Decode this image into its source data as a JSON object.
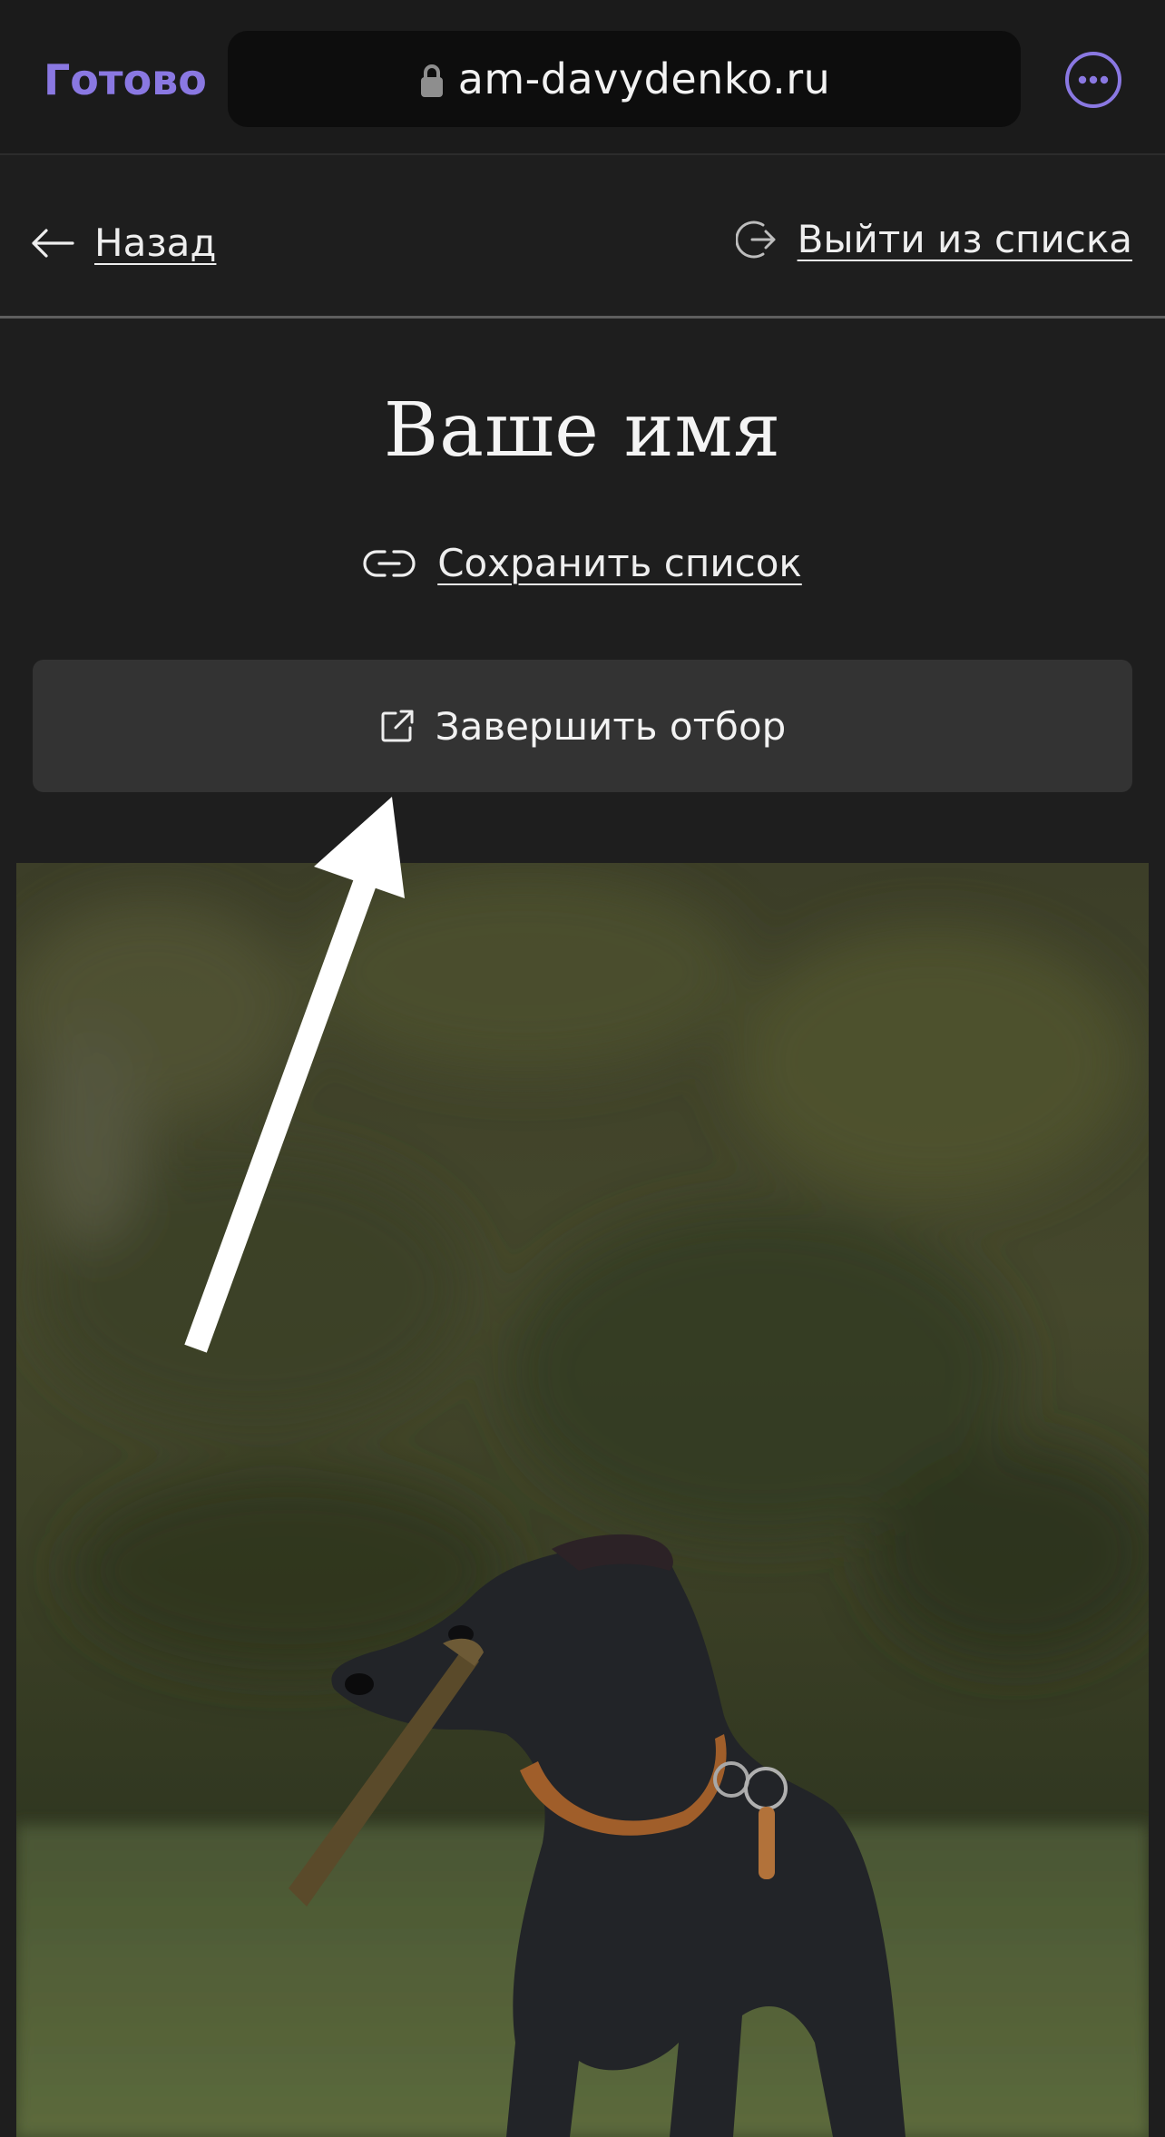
{
  "browser": {
    "done_label": "Готово",
    "url": "am-davydenko.ru",
    "accent_color": "#8a78e2",
    "lock_icon": "lock-icon",
    "more_icon": "ellipsis-circle-icon"
  },
  "nav": {
    "back_label": "Назад",
    "exit_label": "Выйти из списка"
  },
  "page": {
    "title": "Ваше имя",
    "save_label": "Сохранить список",
    "finish_label": "Завершить отбор"
  },
  "photo": {
    "subject_icon": "dog-photo"
  }
}
